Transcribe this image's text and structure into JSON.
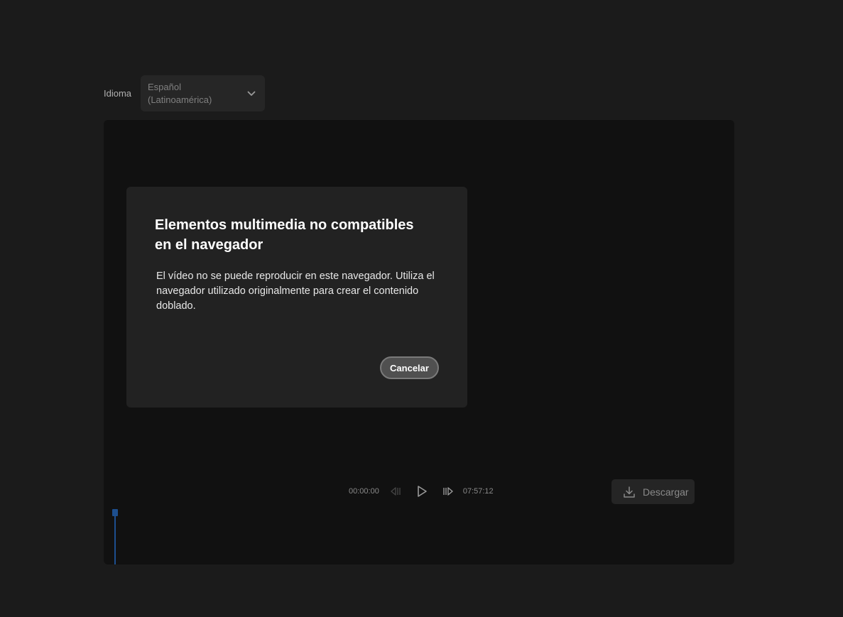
{
  "language": {
    "label": "Idioma",
    "selected": "Español\n(Latinoamérica)",
    "chevron_icon": "chevron-down-icon"
  },
  "dialog": {
    "title": "Elementos multimedia no compatibles en el navegador",
    "body": "El vídeo no se puede reproducir en este navegador. Utiliza el navegador utilizado originalmente para crear el contenido doblado.",
    "cancel_label": "Cancelar"
  },
  "player": {
    "current_time": "00:00:00",
    "total_time": "07:57:12",
    "icons": {
      "previous": "skip-back-icon",
      "play": "play-icon",
      "next": "skip-forward-icon",
      "download": "download-icon"
    },
    "download_label": "Descargar"
  },
  "colors": {
    "background": "#1b1b1b",
    "player_bg": "#111111",
    "dialog_bg": "#222222",
    "accent_playhead": "#1d4f8f"
  }
}
